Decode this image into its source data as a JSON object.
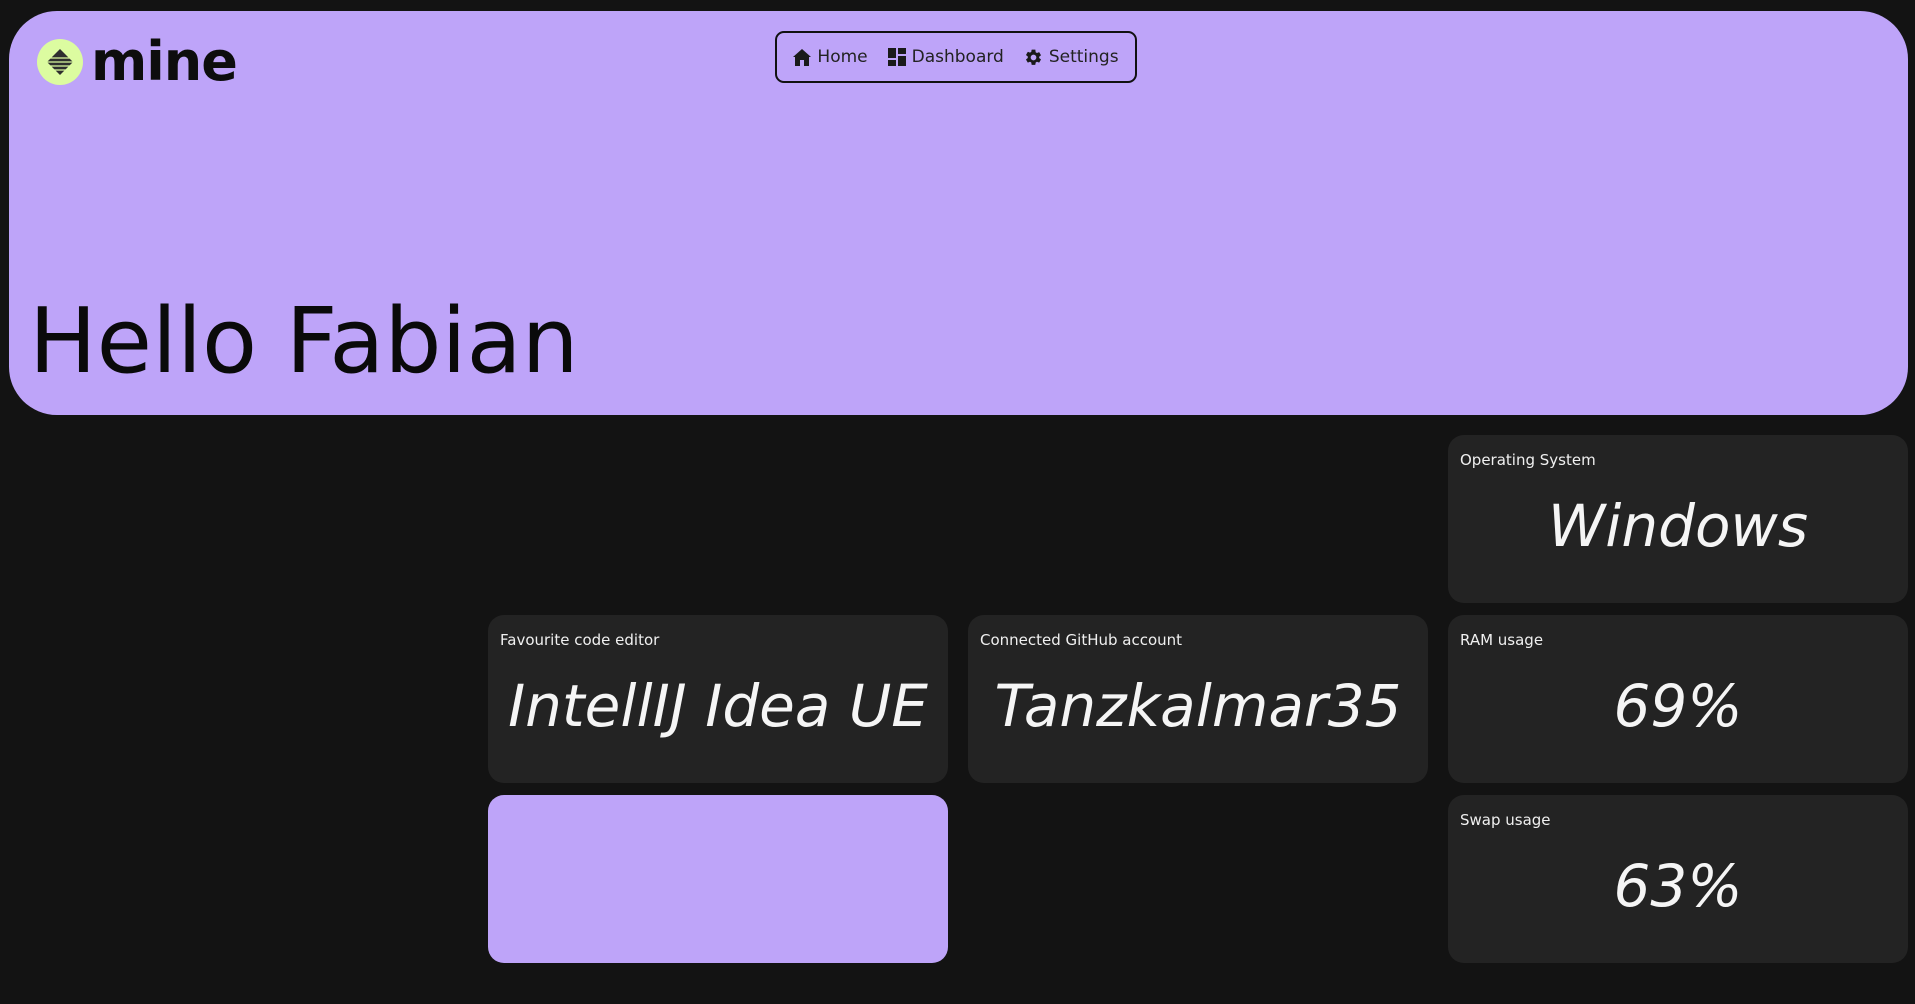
{
  "app": {
    "name": "mine",
    "brand_color": "#bea4f9",
    "logo_color": "#dcfca0"
  },
  "nav": {
    "items": [
      {
        "label": "Home",
        "icon": "home-icon"
      },
      {
        "label": "Dashboard",
        "icon": "dashboard-icon"
      },
      {
        "label": "Settings",
        "icon": "gear-icon"
      }
    ]
  },
  "hero": {
    "greeting": "Hello Fabian"
  },
  "cards": {
    "os": {
      "label": "Operating System",
      "value": "Windows"
    },
    "editor": {
      "label": "Favourite code editor",
      "value": "IntellIJ Idea UE"
    },
    "github": {
      "label": "Connected GitHub account",
      "value": "Tanzkalmar35"
    },
    "ram": {
      "label": "RAM usage",
      "value": "69%"
    },
    "swap": {
      "label": "Swap usage",
      "value": "63%"
    }
  }
}
